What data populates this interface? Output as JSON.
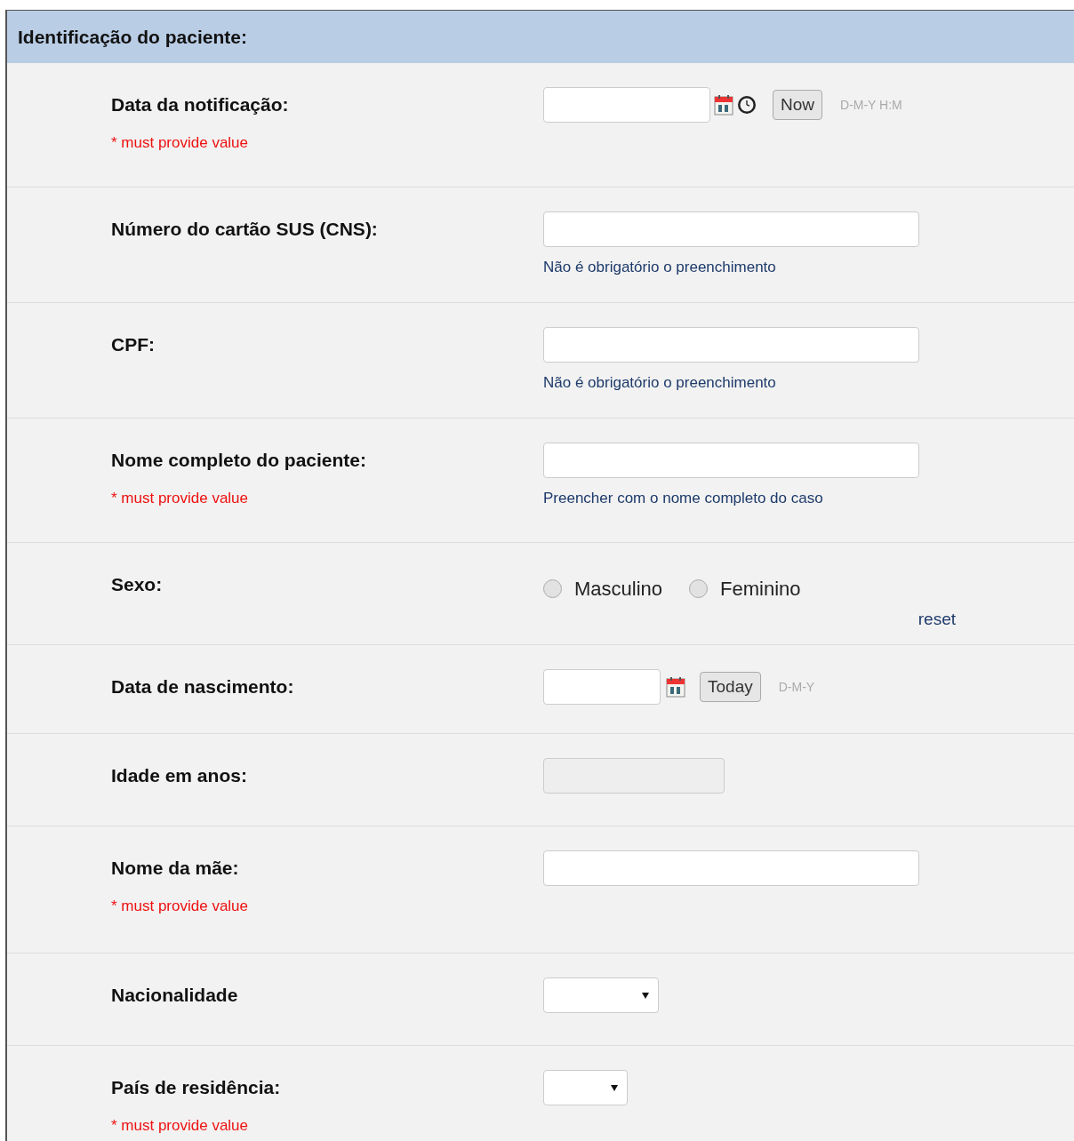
{
  "section": {
    "title": "Identificação do paciente:"
  },
  "fields": [
    {
      "kind": "datetime",
      "label": "Data da notificação:",
      "required_note": "* must provide value",
      "button": "Now",
      "format": "D-M-Y H:M"
    },
    {
      "kind": "text",
      "label": "Número do cartão SUS (CNS):",
      "hint": "Não é obrigatório o preenchimento"
    },
    {
      "kind": "text",
      "label": "CPF:",
      "hint": "Não é obrigatório o preenchimento"
    },
    {
      "kind": "text",
      "label": "Nome completo do paciente:",
      "required_note": "* must provide value",
      "hint": "Preencher com o nome completo do caso"
    },
    {
      "kind": "radio",
      "label": "Sexo:",
      "options": [
        {
          "label": "Masculino",
          "selected": false
        },
        {
          "label": "Feminino",
          "selected": false
        }
      ],
      "reset": "reset"
    },
    {
      "kind": "date",
      "label": "Data de nascimento:",
      "button": "Today",
      "format": "D-M-Y"
    },
    {
      "kind": "readonly",
      "label": "Idade em anos:"
    },
    {
      "kind": "text",
      "label": "Nome da mãe:",
      "required_note": "* must provide value"
    },
    {
      "kind": "select",
      "label": "Nacionalidade"
    },
    {
      "kind": "select_small",
      "label": "País de residência:",
      "required_note": "* must provide value"
    }
  ]
}
